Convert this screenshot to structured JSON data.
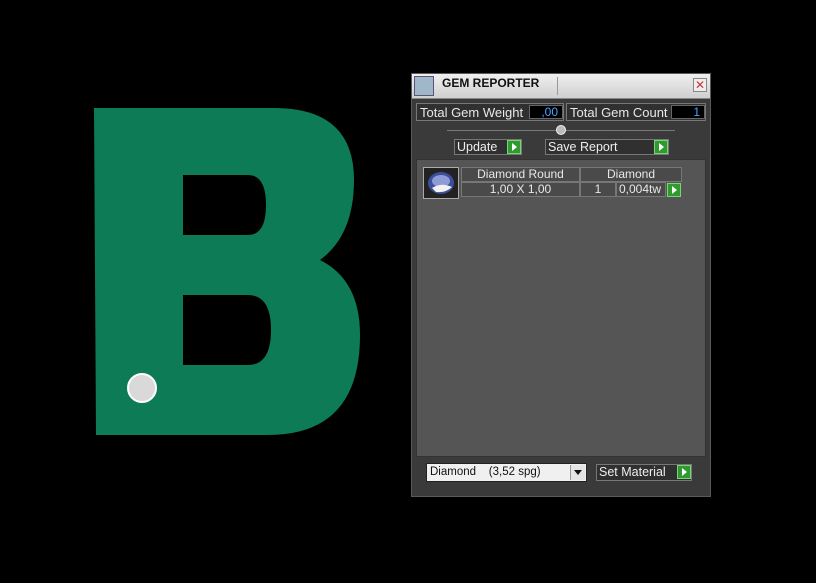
{
  "viewport": {
    "letter": "B",
    "letter_color": "#0e7b57"
  },
  "panel": {
    "title": "GEM REPORTER",
    "close_glyph": "✕",
    "total_gem_weight": {
      "label": "Total Gem Weight",
      "value": ",00"
    },
    "total_gem_count": {
      "label": "Total Gem Count",
      "value": "1"
    },
    "buttons": {
      "update": "Update",
      "save_report": "Save Report",
      "set_material": "Set Material"
    },
    "gem_row": {
      "name": "Diamond Round",
      "material": "Diamond",
      "size": "1,00 X 1,00",
      "count": "1",
      "weight": "0,004tw"
    },
    "material_select": {
      "value": "Diamond    (3,52 spg)"
    }
  },
  "colors": {
    "go_green": "#2f9b2f",
    "value_blue": "#4aa3ff"
  }
}
